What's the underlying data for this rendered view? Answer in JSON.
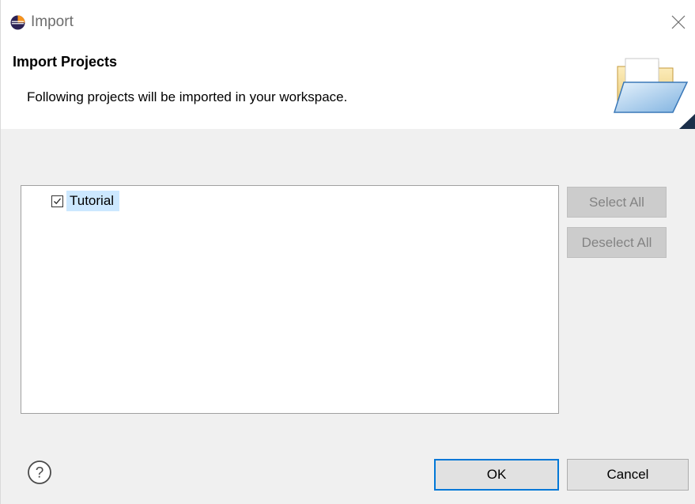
{
  "window": {
    "title": "Import",
    "close_icon": "close-icon",
    "app_icon": "eclipse-icon"
  },
  "banner": {
    "title": "Import Projects",
    "description": "Following projects will be imported in your workspace.",
    "icon": "open-folder-icon"
  },
  "projects": {
    "items": [
      {
        "label": "Tutorial",
        "checked": true,
        "selected": true
      }
    ]
  },
  "side_buttons": {
    "select_all": "Select All",
    "deselect_all": "Deselect All"
  },
  "footer": {
    "help_icon": "help-icon",
    "ok": "OK",
    "cancel": "Cancel"
  },
  "colors": {
    "selection": "#cce8ff",
    "default_button_border": "#0078d7",
    "dialog_background": "#f0f0f0",
    "disabled_button": "#cccccc",
    "disabled_text": "#838383"
  }
}
